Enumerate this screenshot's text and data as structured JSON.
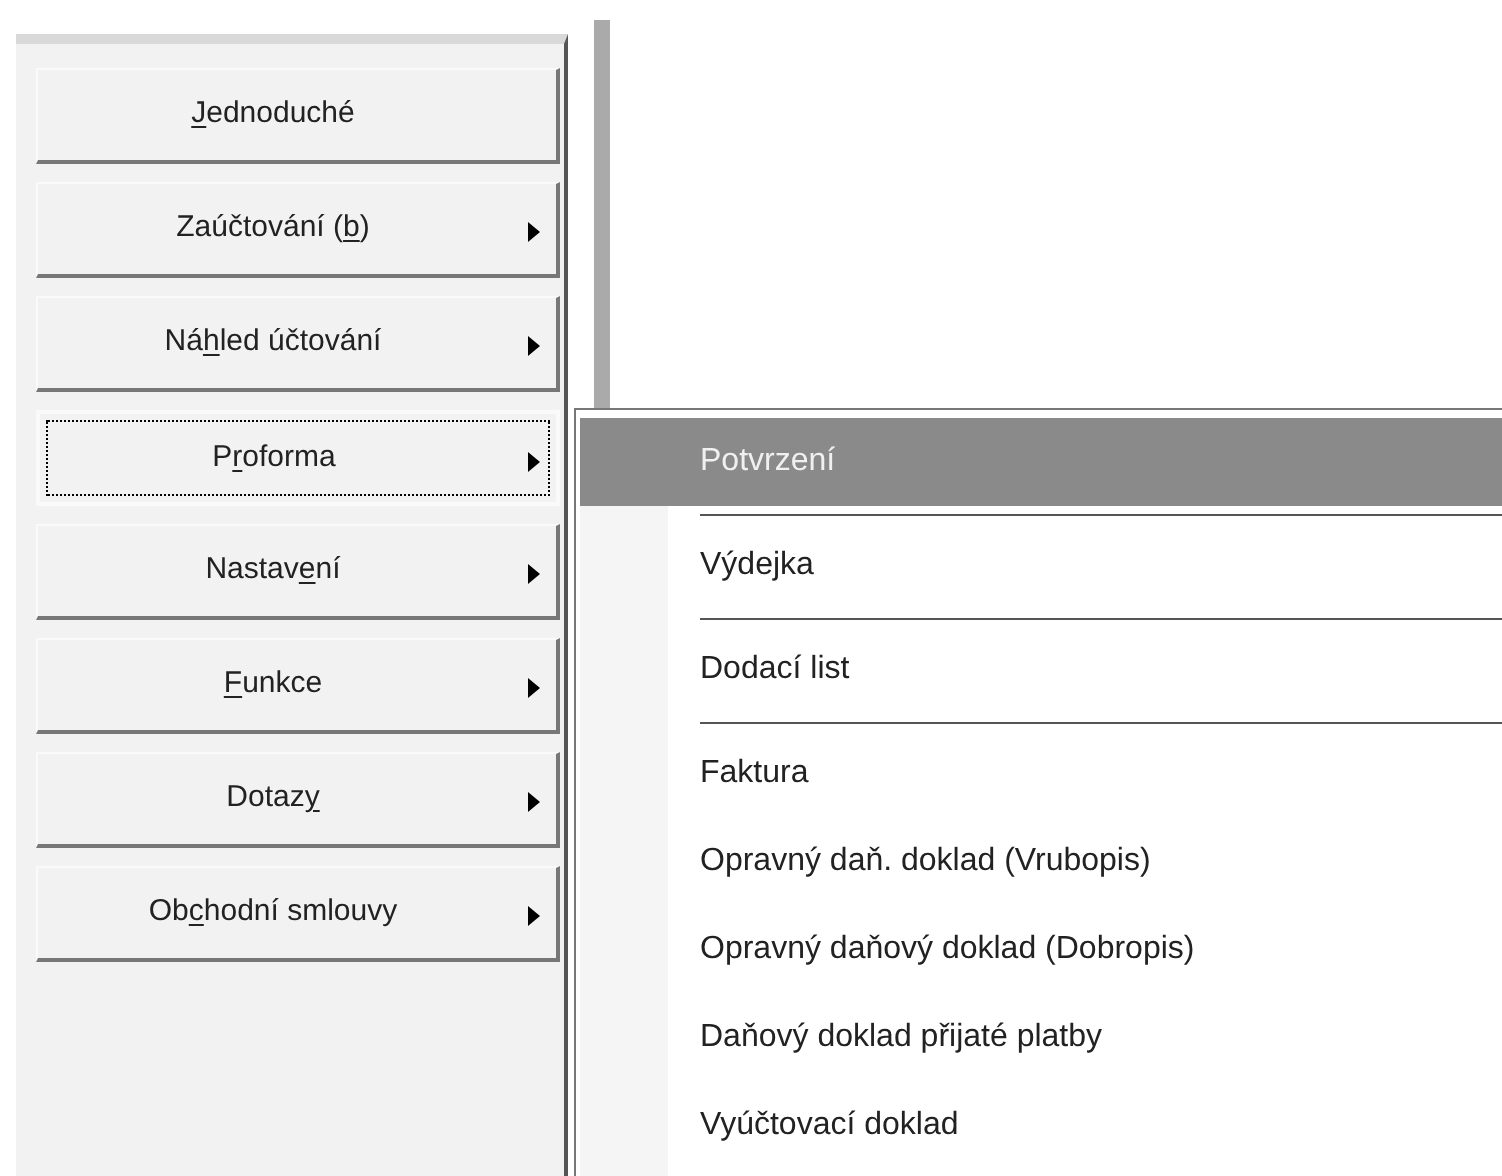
{
  "buttons": [
    {
      "label": {
        "key": "J",
        "after": "ednoduché"
      },
      "has_submenu": false,
      "focused": false
    },
    {
      "label": {
        "before": "Zaúčtování (",
        "key": "b",
        "after": ")"
      },
      "has_submenu": true,
      "focused": false
    },
    {
      "label": {
        "before": "Ná",
        "key": "h",
        "after": "led účtování"
      },
      "has_submenu": true,
      "focused": false
    },
    {
      "label": {
        "before": "P",
        "key": "r",
        "after": "oforma"
      },
      "has_submenu": true,
      "focused": true
    },
    {
      "label": {
        "before": "Nastav",
        "key": "e",
        "after": "ní"
      },
      "has_submenu": true,
      "focused": false
    },
    {
      "label": {
        "key": "F",
        "after": "unkce"
      },
      "has_submenu": true,
      "focused": false
    },
    {
      "label": {
        "before": "Dotaz",
        "key": "y"
      },
      "has_submenu": true,
      "focused": false
    },
    {
      "label": {
        "before": "Ob",
        "key": "c",
        "after": "hodní smlouvy"
      },
      "has_submenu": true,
      "focused": false
    }
  ],
  "submenu": [
    {
      "kind": "item",
      "label": "Potvrzení",
      "selected": true
    },
    {
      "kind": "separator"
    },
    {
      "kind": "item",
      "label": "Výdejka",
      "selected": false
    },
    {
      "kind": "separator"
    },
    {
      "kind": "item",
      "label": "Dodací list",
      "selected": false
    },
    {
      "kind": "separator"
    },
    {
      "kind": "item",
      "label": "Faktura",
      "selected": false
    },
    {
      "kind": "item",
      "label": "Opravný daň. doklad (Vrubopis)",
      "selected": false
    },
    {
      "kind": "item",
      "label": "Opravný daňový doklad (Dobropis)",
      "selected": false
    },
    {
      "kind": "item",
      "label": "Daňový doklad přijaté platby",
      "selected": false
    },
    {
      "kind": "item",
      "label": "Vyúčtovací doklad",
      "selected": false
    }
  ]
}
